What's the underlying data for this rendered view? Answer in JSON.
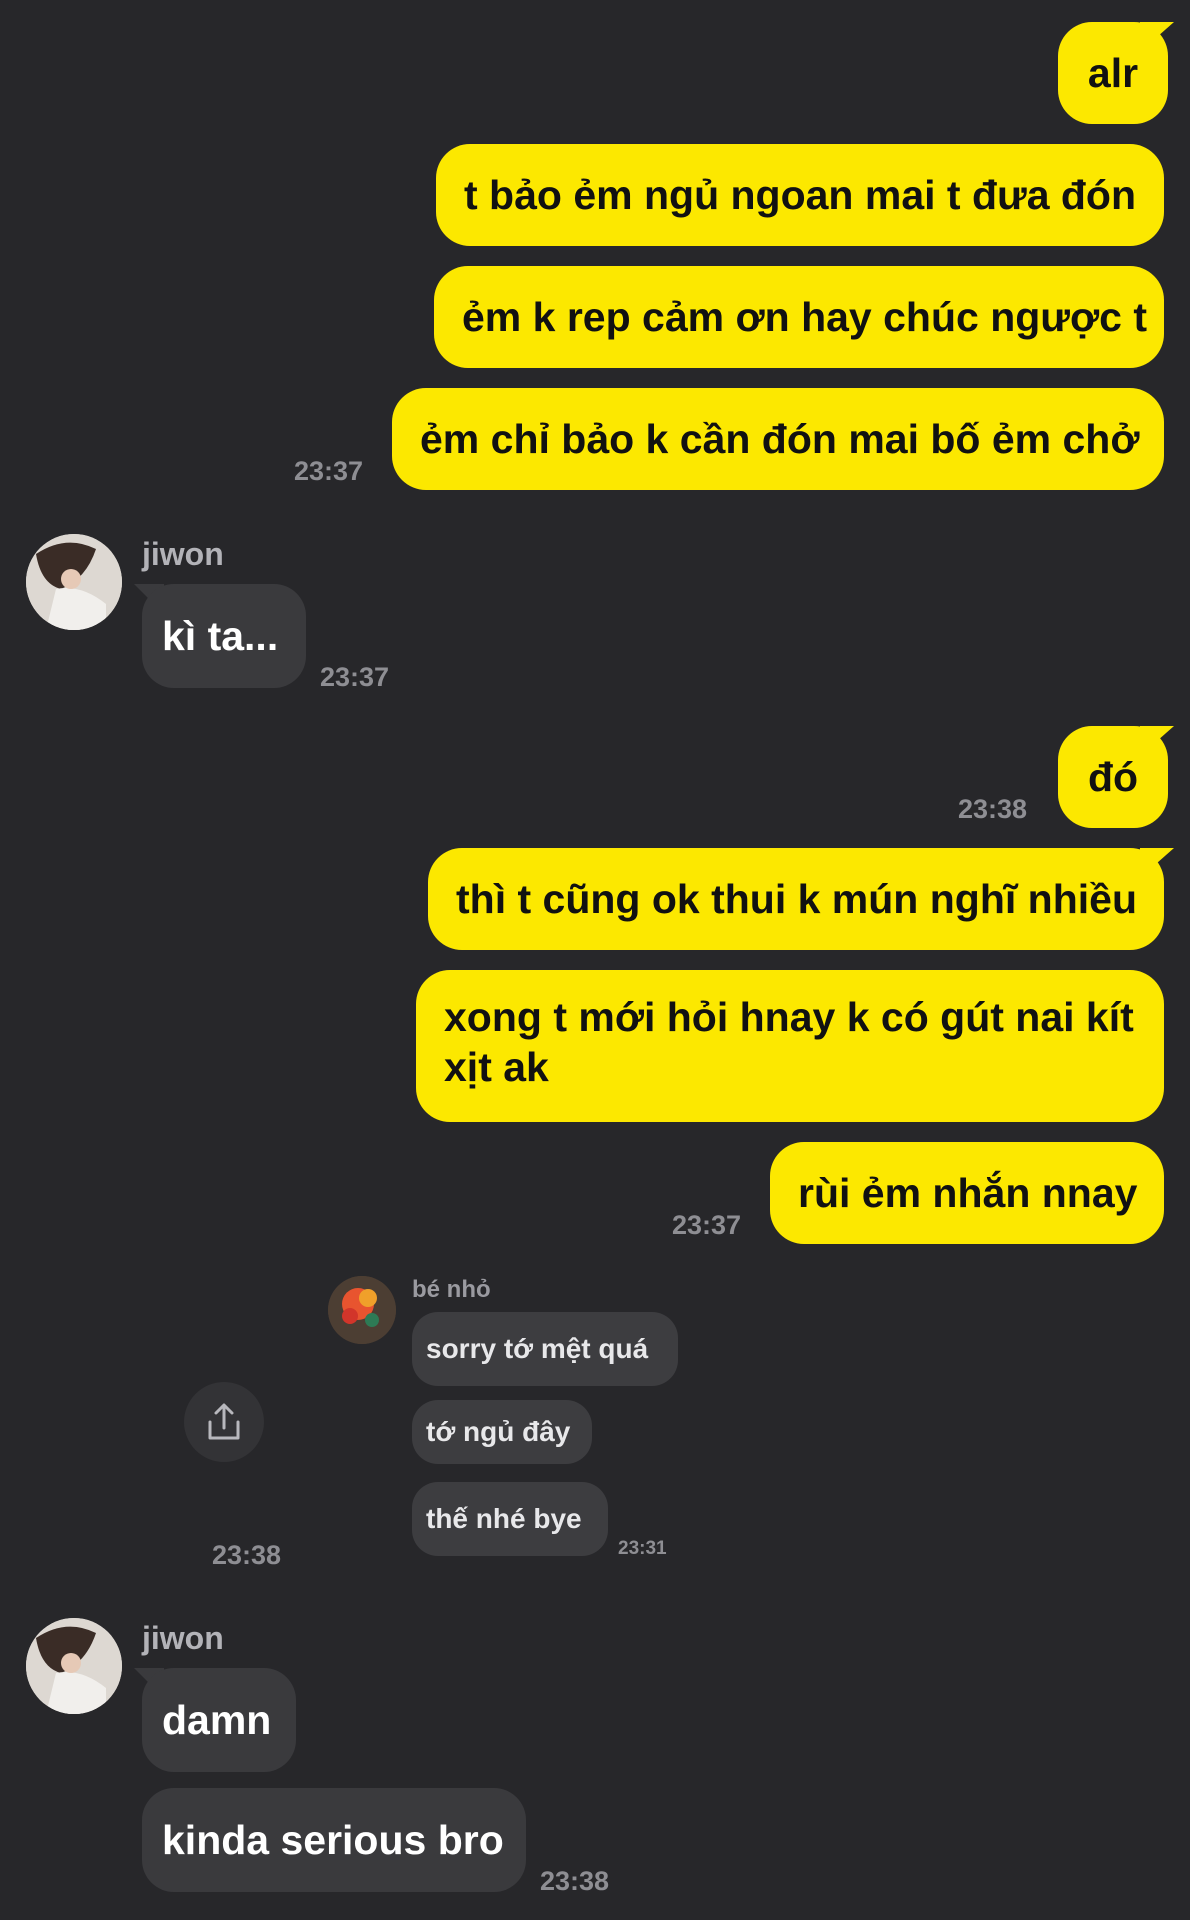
{
  "colors": {
    "background": "#27272a",
    "my_bubble": "#fce800",
    "their_bubble": "#3a3a3d",
    "timestamp": "#8e8e93"
  },
  "messages": {
    "m1": "alr",
    "m2": "t bảo ẻm ngủ ngoan mai t đưa đón",
    "m3": "ẻm k rep cảm ơn hay chúc ngược t",
    "m4": "ẻm chỉ bảo k cần đón mai bố ẻm chở",
    "t4": "23:37",
    "sender1": "jiwon",
    "m5": "kì ta...",
    "t5": "23:37",
    "m6": "đó",
    "t6": "23:38",
    "m7": "thì t cũng ok thui k mún nghĩ nhiều",
    "m8": "xong t mới hỏi hnay k có gút nai kít xịt ak",
    "m9": "rùi ẻm nhắn nnay",
    "t9": "23:37",
    "t_image": "23:38",
    "sender2": "jiwon",
    "m10": "damn",
    "m11": "kinda serious bro",
    "t11": "23:38"
  },
  "forwarded_image": {
    "sender": "bé nhỏ",
    "lines": [
      "sorry tớ mệt quá",
      "tớ ngủ đây",
      "thế nhé bye"
    ],
    "time": "23:31"
  },
  "icons": {
    "share": "share-icon"
  }
}
